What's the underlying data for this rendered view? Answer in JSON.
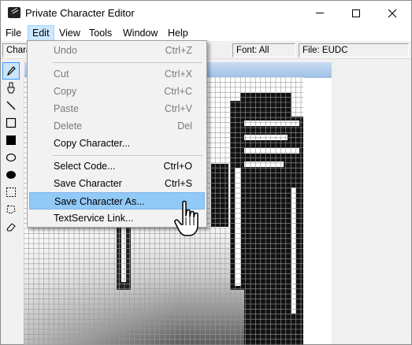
{
  "window": {
    "title": "Private Character Editor",
    "caption_buttons": {
      "minimize": "minimize-icon",
      "maximize": "maximize-icon",
      "close": "close-icon"
    }
  },
  "menubar": [
    "File",
    "Edit",
    "View",
    "Tools",
    "Window",
    "Help"
  ],
  "infobar": {
    "character_label": "Chara",
    "font": "Font: All",
    "file": "File: EUDC"
  },
  "tools": [
    "pencil-icon",
    "brush-icon",
    "line-icon",
    "hollow-rectangle-icon",
    "filled-rectangle-icon",
    "hollow-ellipse-icon",
    "filled-ellipse-icon",
    "rectangular-selection-icon",
    "freeform-selection-icon",
    "eraser-icon"
  ],
  "edit_menu": {
    "items": [
      {
        "label": "Undo",
        "shortcut": "Ctrl+Z",
        "enabled": false
      },
      {
        "label": "Cut",
        "shortcut": "Ctrl+X",
        "enabled": false
      },
      {
        "label": "Copy",
        "shortcut": "Ctrl+C",
        "enabled": false
      },
      {
        "label": "Paste",
        "shortcut": "Ctrl+V",
        "enabled": false
      },
      {
        "label": "Delete",
        "shortcut": "Del",
        "enabled": false
      },
      {
        "label": "Copy Character...",
        "shortcut": "",
        "enabled": true
      },
      {
        "label": "Select Code...",
        "shortcut": "Ctrl+O",
        "enabled": true
      },
      {
        "label": "Save Character",
        "shortcut": "Ctrl+S",
        "enabled": true
      },
      {
        "label": "Save Character As...",
        "shortcut": "",
        "enabled": true,
        "highlighted": true
      },
      {
        "label": "TextService Link...",
        "shortcut": "",
        "enabled": true
      }
    ]
  },
  "colors": {
    "menu_highlight": "#91c9f7",
    "edit_menu_active": "#cce8ff",
    "editor_titlebar": "#9fc0e6"
  }
}
